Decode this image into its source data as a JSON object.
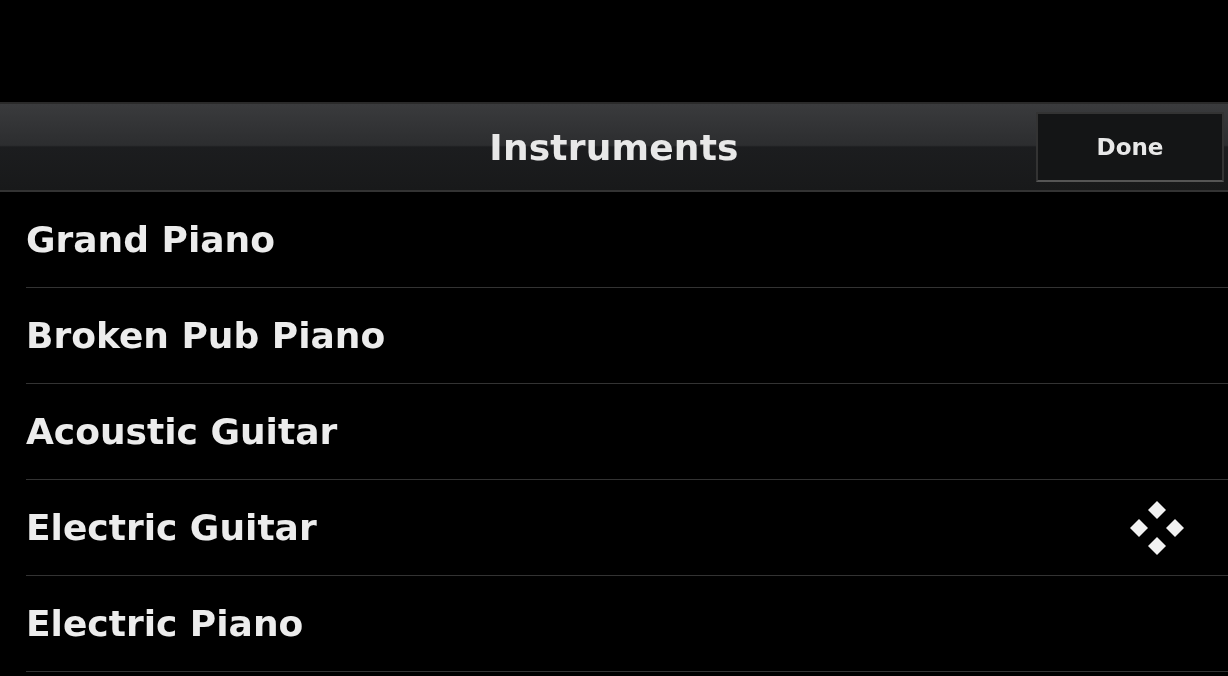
{
  "header": {
    "title": "Instruments",
    "done_button": "Done"
  },
  "instruments": [
    {
      "name": "Grand Piano",
      "selected": false
    },
    {
      "name": "Broken Pub Piano",
      "selected": false
    },
    {
      "name": "Acoustic Guitar",
      "selected": false
    },
    {
      "name": "Electric Guitar",
      "selected": true
    },
    {
      "name": "Electric Piano",
      "selected": false
    }
  ]
}
